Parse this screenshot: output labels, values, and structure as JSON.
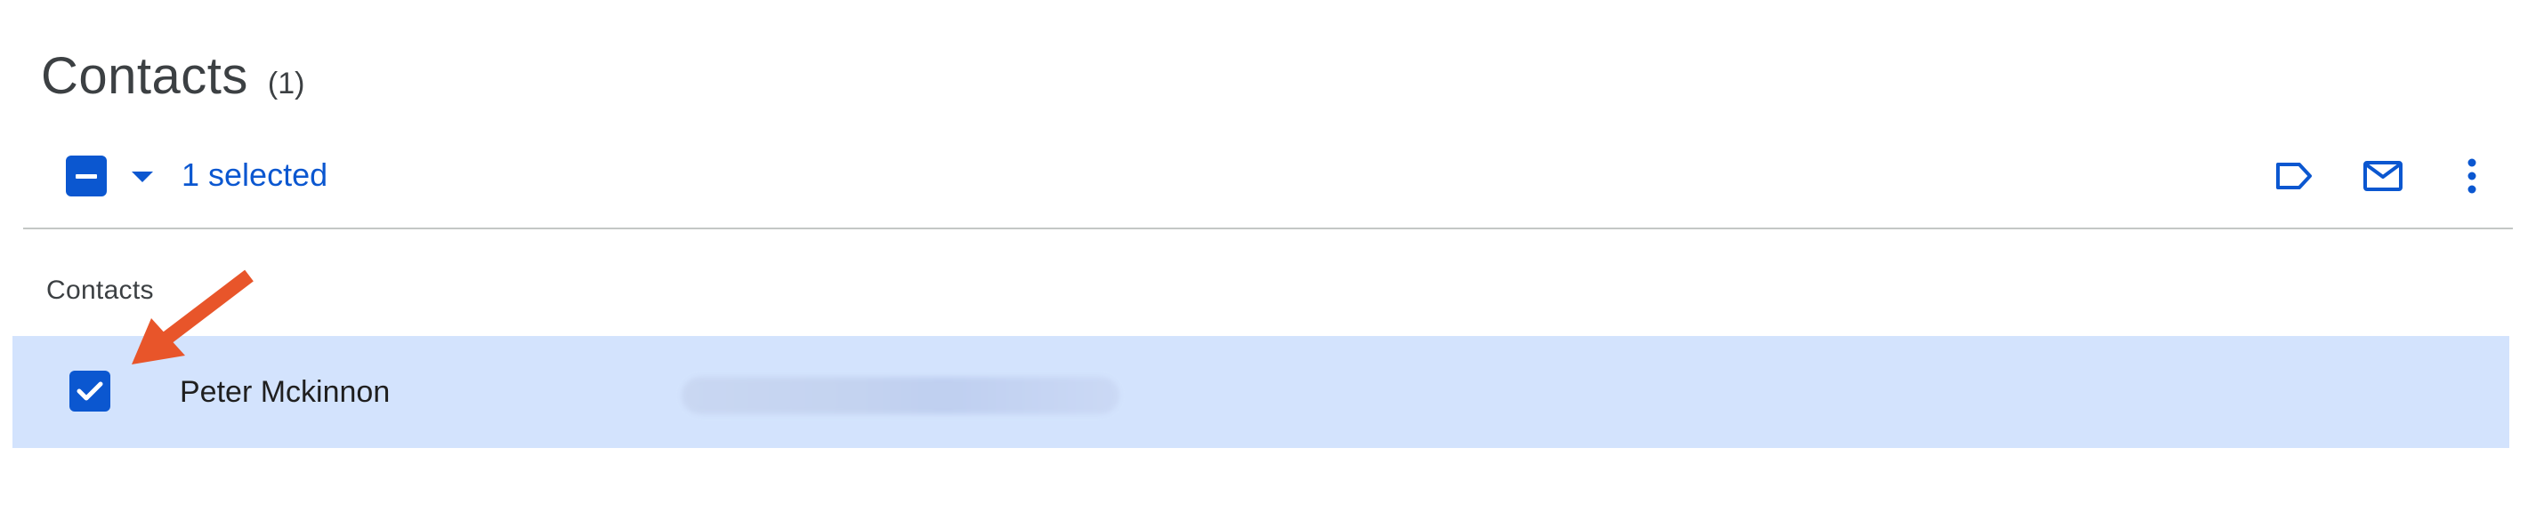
{
  "header": {
    "title": "Contacts",
    "count": "(1)"
  },
  "toolbar": {
    "selection_label": "1 selected",
    "select_all_state": "indeterminate",
    "actions": [
      {
        "icon": "label-icon"
      },
      {
        "icon": "mail-icon"
      },
      {
        "icon": "more-vert-icon"
      }
    ]
  },
  "section": {
    "label": "Contacts"
  },
  "contacts": [
    {
      "name": "Peter Mckinnon",
      "checked": true,
      "email_obscured": true
    }
  ],
  "colors": {
    "accent": "#0b57d0",
    "selected_row": "#d3e3fd",
    "annotation_arrow": "#e8552a",
    "divider": "#c4c7c5"
  }
}
